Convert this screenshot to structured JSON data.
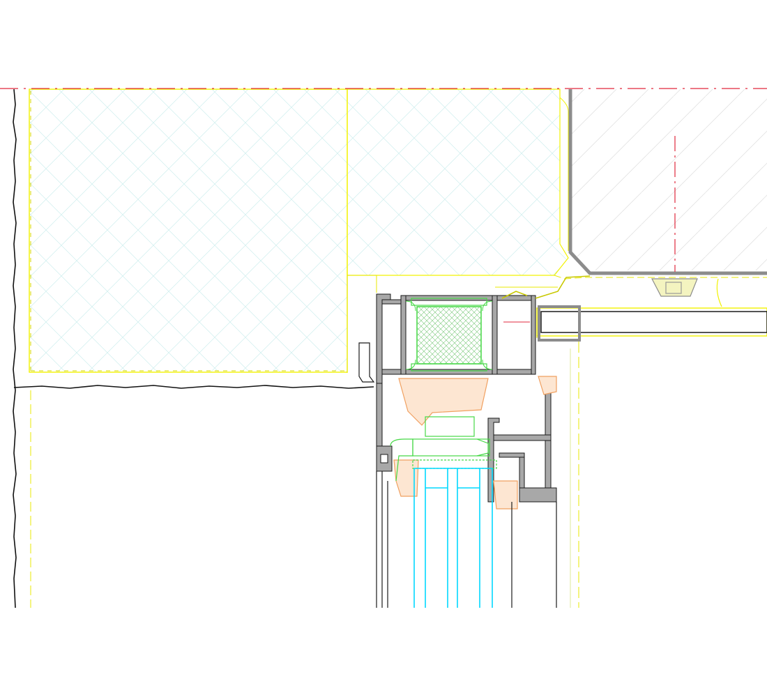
{
  "drawing": {
    "kind": "cad-section-detail",
    "background": "#ffffff",
    "palette": {
      "grid_line": "#bfe8e6",
      "outline_yellow": "#f2f200",
      "axis_red": "#e0283c",
      "profile_gray": "#8c8c8c",
      "profile_dark": "#1a1a1a",
      "seal_green": "#45d845",
      "gasket_orange": "#f0a060",
      "glass_cyan": "#00d8ff",
      "hatch_wall": "#d8d8d8",
      "break_line": "#111111",
      "insulation": "#60b860"
    },
    "layers": [
      "insulation-hatch",
      "wall-hatch",
      "structure-outline",
      "aluminium-profile",
      "thermal-break",
      "gaskets",
      "glazing",
      "center-lines",
      "break-lines"
    ]
  }
}
